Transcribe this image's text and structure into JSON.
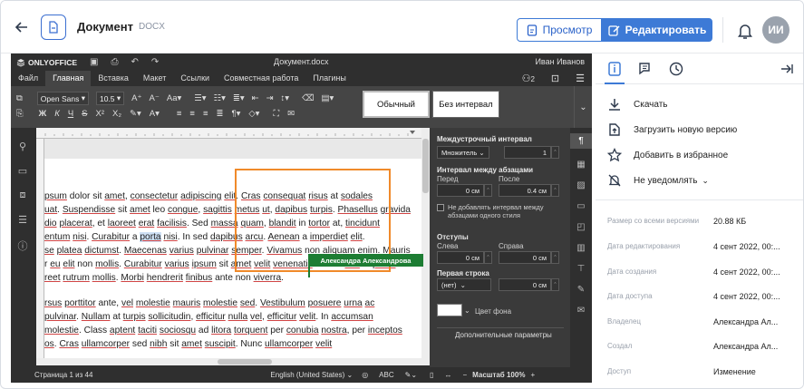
{
  "header": {
    "doc_title": "Документ",
    "doc_ext": "DOCX",
    "view_label": "Просмотр",
    "edit_label": "Редактировать",
    "avatar_initials": "ИИ"
  },
  "editor": {
    "brand": "ONLYOFFICE",
    "file_title": "Документ.docx",
    "user_name": "Иван Иванов",
    "users_count": "2",
    "menu": [
      "Файл",
      "Главная",
      "Вставка",
      "Макет",
      "Ссылки",
      "Совместная работа",
      "Плагины"
    ],
    "active_menu": "Главная",
    "font_name": "Open Sans",
    "font_size": "10.5",
    "styles": [
      "Обычный",
      "Без интервал"
    ],
    "collab_user": "Александра Александрова",
    "paragraphs": [
      "psum dolor sit amet, consectetur adipiscing elit. Cras consequat risus at sodales",
      "uat. Suspendisse sit amet leo congue, sagittis metus ut, dapibus turpis. Phasellus gravida",
      "dio placerat, et laoreet erat facilisis. Sed massa quam, blandit in tortor at, tincidunt",
      "entum nisi. Curabitur a porta nisi. In sed dapibus arcu. Aenean a imperdiet elit.",
      "se platea dictumst. Maecenas varius pulvinar semper. Vivamus non aliquam enim. Mauris",
      "r eu elit non mollis. Curabitur varius ipsum sit amet velit venenatis dictum sed ut purus.",
      "reet rutrum mollis. Morbi hendrerit finibus ante non viverra.",
      "rsus porttitor ante, vel molestie mauris molestie sed. Vestibulum posuere urna ac",
      "pulvinar. Nullam at turpis sollicitudin, efficitur nulla vel, efficitur velit. In accumsan",
      "molestie. Class aptent taciti sociosqu ad litora torquent per conubia nostra, per inceptos",
      "os. Cras ullamcorper sed nibh sit amet suscipit. Nunc ullamcorper velit"
    ],
    "panel": {
      "line_spacing_label": "Междустрочный интервал",
      "line_spacing_mode": "Множитель",
      "line_spacing_value": "1",
      "para_spacing_label": "Интервал между абзацами",
      "before_label": "Перед",
      "after_label": "После",
      "before_value": "0 см",
      "after_value": "0.4 см",
      "no_interval_label": "Не добавлять интервал между абзацами одного стиля",
      "indents_label": "Отступы",
      "left_label": "Слева",
      "right_label": "Справа",
      "left_value": "0 см",
      "right_value": "0 см",
      "first_line_label": "Первая строка",
      "first_line_mode": "(нет)",
      "first_line_value": "0 см",
      "bg_color_label": "Цвет фона",
      "advanced_label": "Дополнительные параметры"
    },
    "status": {
      "page": "Страница 1 из 44",
      "language": "English (United States)",
      "zoom": "Масштаб 100%"
    }
  },
  "sidebar": {
    "actions": [
      "Скачать",
      "Загрузить новую версию",
      "Добавить в избранное",
      "Не уведомлять"
    ],
    "properties": [
      {
        "key": "Размер со всеми версиями",
        "value": "20.88 КБ"
      },
      {
        "key": "Дата редактирования",
        "value": "4 сент 2022, 00:..."
      },
      {
        "key": "Дата создания",
        "value": "4 сент 2022, 00:..."
      },
      {
        "key": "Дата доступа",
        "value": "4 сент 2022, 00:..."
      },
      {
        "key": "Владелец",
        "value": "Александра Ал..."
      },
      {
        "key": "Создал",
        "value": "Александра Ал..."
      },
      {
        "key": "Доступ",
        "value": "Изменение"
      }
    ]
  },
  "colors": {
    "accent": "#3d7ad6",
    "editor_dark": "#2f2f2f",
    "highlight_orange": "#f08a2a",
    "collab_green": "#1d7d33"
  }
}
